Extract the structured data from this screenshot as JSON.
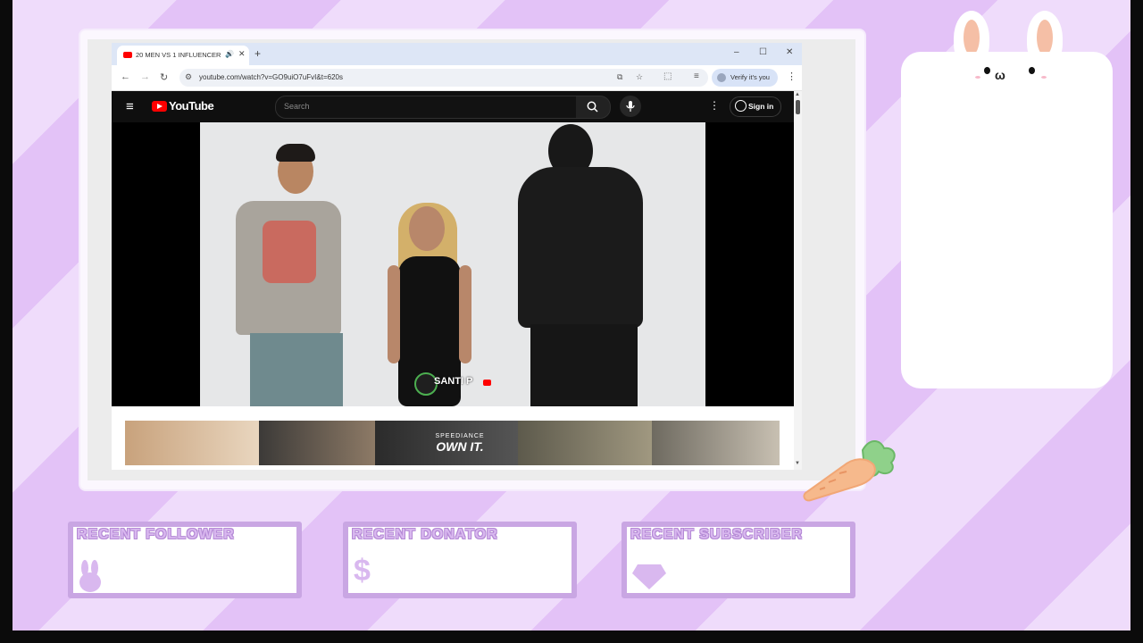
{
  "browser": {
    "tab_title": "20 MEN VS 1 INFLUENCER:",
    "new_tab": "+",
    "url": "youtube.com/watch?v=GO9uiO7uFvI&t=620s",
    "verify_label": "Verify it's you",
    "window_controls": [
      "–",
      "☐",
      "✕"
    ]
  },
  "youtube": {
    "logo_text": "YouTube",
    "search_placeholder": "Search",
    "sign_in": "Sign in"
  },
  "video": {
    "watermark": "SANTI P"
  },
  "ad": {
    "line1": "SPEEDIANCE",
    "line2": "OWN IT."
  },
  "widgets": [
    {
      "label": "RECENT FOLLOWER",
      "icon": "bunny-icon"
    },
    {
      "label": "RECENT DONATOR",
      "icon": "dollar-icon"
    },
    {
      "label": "RECENT SUBSCRIBER",
      "icon": "gem-icon"
    }
  ],
  "colors": {
    "overlay_light": "#efdcfb",
    "overlay_stripe": "#e3c2f7",
    "widget_border": "#c9a6e3",
    "youtube_red": "#ff0000"
  }
}
